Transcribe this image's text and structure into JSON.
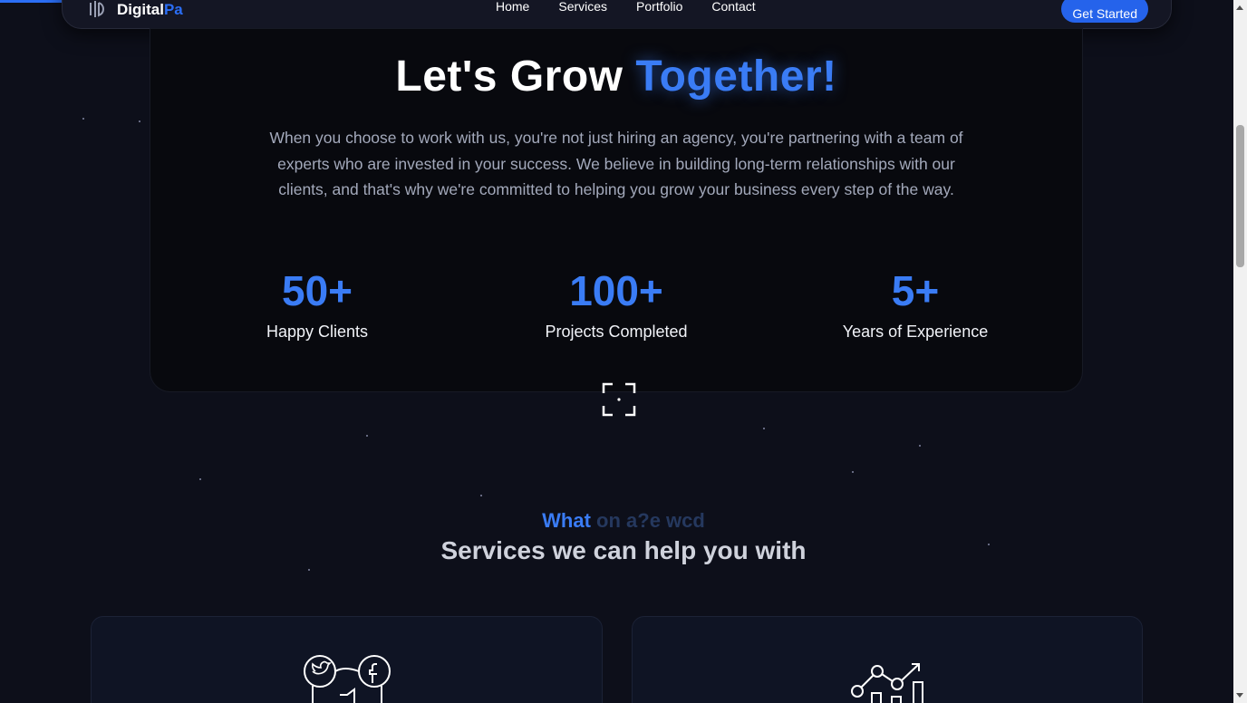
{
  "brand": {
    "name_main": "Digital",
    "name_accent": "Pa"
  },
  "nav": {
    "links": [
      "Home",
      "Services",
      "Portfolio",
      "Contact"
    ],
    "cta": "Get Started"
  },
  "hero": {
    "title_main": "Let's Grow",
    "title_accent": "Together!",
    "description": "When you choose to work with us, you're not just hiring an agency, you're partnering with a team of experts who are invested in your success. We believe in building long-term relationships with our clients, and that's why we're committed to helping you grow your business every step of the way.",
    "stats": [
      {
        "value": "50+",
        "label": "Happy Clients"
      },
      {
        "value": "100+",
        "label": "Projects Completed"
      },
      {
        "value": "5+",
        "label": "Years of Experience"
      }
    ]
  },
  "services": {
    "eyebrow_main": "What",
    "eyebrow_rest": "on a?e wcd",
    "title": "Services we can help you with"
  },
  "colors": {
    "accent": "#3a7cf5",
    "button": "#2563eb",
    "background": "#0d0f1a"
  }
}
